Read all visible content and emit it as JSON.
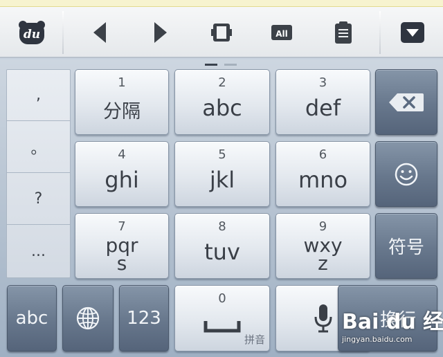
{
  "toolbar": {
    "icons": [
      "du-logo-icon",
      "cursor-left-icon",
      "cursor-right-icon",
      "select-icon",
      "select-all-icon",
      "clipboard-icon",
      "collapse-keyboard-icon"
    ],
    "logo_text": "du",
    "select_all_text": "All"
  },
  "symbols": [
    ",",
    "。",
    "?",
    "..."
  ],
  "keys": {
    "k1": {
      "num": "1",
      "label": "分隔"
    },
    "k2": {
      "num": "2",
      "label": "abc"
    },
    "k3": {
      "num": "3",
      "label": "def"
    },
    "k4": {
      "num": "4",
      "label": "ghi"
    },
    "k5": {
      "num": "5",
      "label": "jkl"
    },
    "k6": {
      "num": "6",
      "label": "mno"
    },
    "k7": {
      "num": "7",
      "line1": "pqr",
      "line2": "s"
    },
    "k8": {
      "num": "8",
      "label": "tuv"
    },
    "k9": {
      "num": "9",
      "line1": "wxy",
      "line2": "z"
    },
    "k0": {
      "num": "0",
      "sub": "拼音"
    }
  },
  "side": {
    "symbol_label": "符号"
  },
  "bottom": {
    "abc_label": "abc",
    "num_label": "123",
    "enter_label": "换行"
  },
  "watermark": {
    "logo": "Bai du 经验",
    "url": "jingyan.baidu.com"
  },
  "colors": {
    "accent_dark": "#2f3540",
    "key_light": "#e3e8ee",
    "key_dark": "#67778c"
  }
}
